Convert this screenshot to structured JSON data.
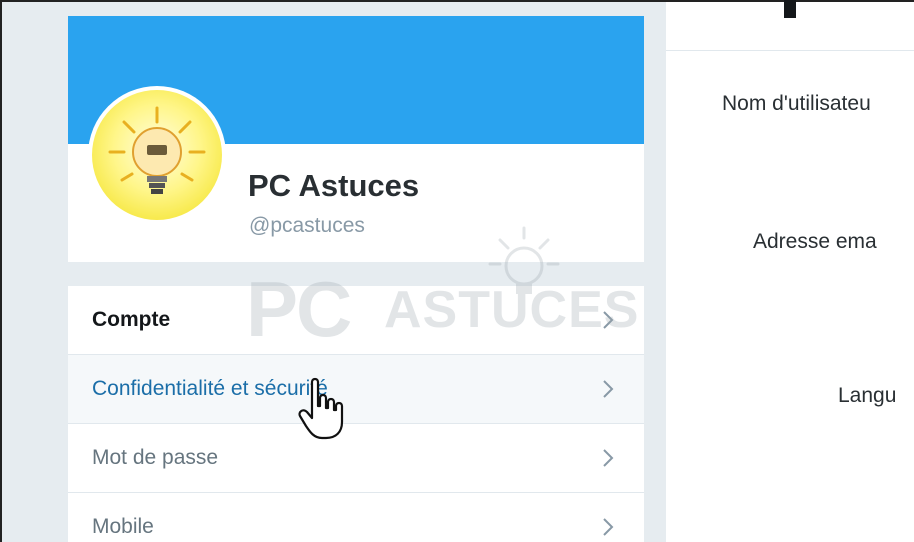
{
  "profile": {
    "display_name": "PC Astuces",
    "handle": "@pcastuces"
  },
  "menu": {
    "items": [
      {
        "label": "Compte",
        "state": "active"
      },
      {
        "label": "Confidentialité et sécurité",
        "state": "hover"
      },
      {
        "label": "Mot de passe",
        "state": "normal"
      },
      {
        "label": "Mobile",
        "state": "normal"
      }
    ],
    "chevron_icon": "chevron-right-icon"
  },
  "account_form": {
    "labels": {
      "username": "Nom d'utilisateu",
      "email": "Adresse ema",
      "language": "Langu"
    }
  },
  "watermark": {
    "logo": "PC ASTUCES"
  },
  "colors": {
    "banner": "#2aa3ef",
    "link_hover": "#1b6ea8",
    "page_bg": "#e6ecf0"
  }
}
